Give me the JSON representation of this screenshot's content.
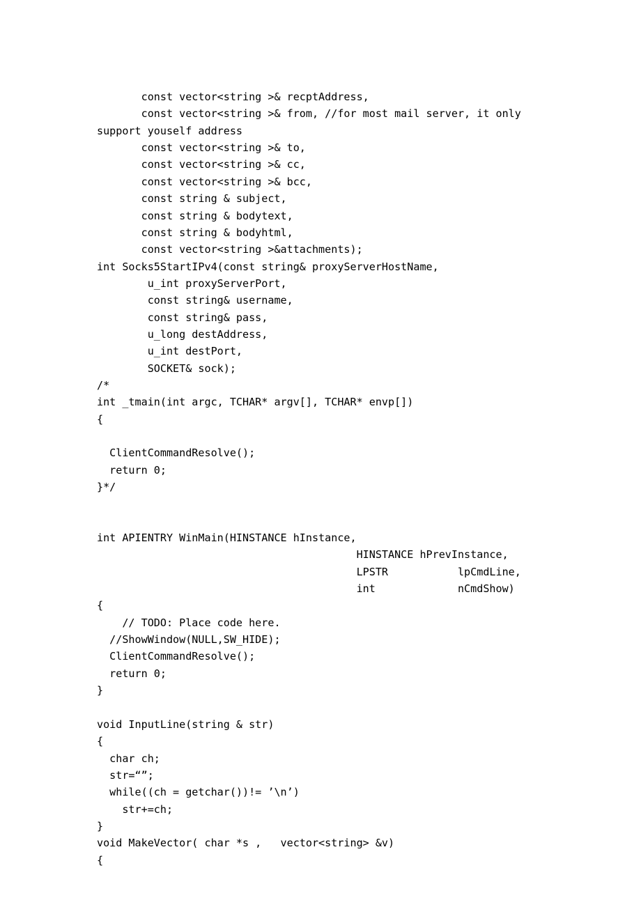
{
  "document": {
    "type": "source-code-listing",
    "language": "C++",
    "page_background": "#ffffff",
    "text_color": "#000000",
    "lines": [
      "       const vector<string >& recptAddress,",
      "       const vector<string >& from, //for most mail server, it only",
      "support youself address",
      "       const vector<string >& to,",
      "       const vector<string >& cc,",
      "       const vector<string >& bcc,",
      "       const string & subject,",
      "       const string & bodytext,",
      "       const string & bodyhtml,",
      "       const vector<string >&attachments);",
      "int Socks5StartIPv4(const string& proxyServerHostName,",
      "        u_int proxyServerPort,",
      "        const string& username,",
      "        const string& pass,",
      "        u_long destAddress,",
      "        u_int destPort,",
      "        SOCKET& sock);",
      "/*",
      "int _tmain(int argc, TCHAR* argv[], TCHAR* envp[])",
      "{",
      "",
      "  ClientCommandResolve();",
      "  return 0;",
      "}*/",
      "",
      "",
      "int APIENTRY WinMain(HINSTANCE hInstance,",
      "                                         HINSTANCE hPrevInstance,",
      "                                         LPSTR           lpCmdLine,",
      "                                         int             nCmdShow)",
      "{",
      "    // TODO: Place code here.",
      "  //ShowWindow(NULL,SW_HIDE);",
      "  ClientCommandResolve();",
      "  return 0;",
      "}",
      "",
      "void InputLine(string & str)",
      "{",
      "  char ch;",
      "  str=“”;",
      "  while((ch = getchar())!= ’\\n’)",
      "    str+=ch;",
      "}",
      "void MakeVector( char *s ,   vector<string> &v)",
      "{"
    ]
  }
}
